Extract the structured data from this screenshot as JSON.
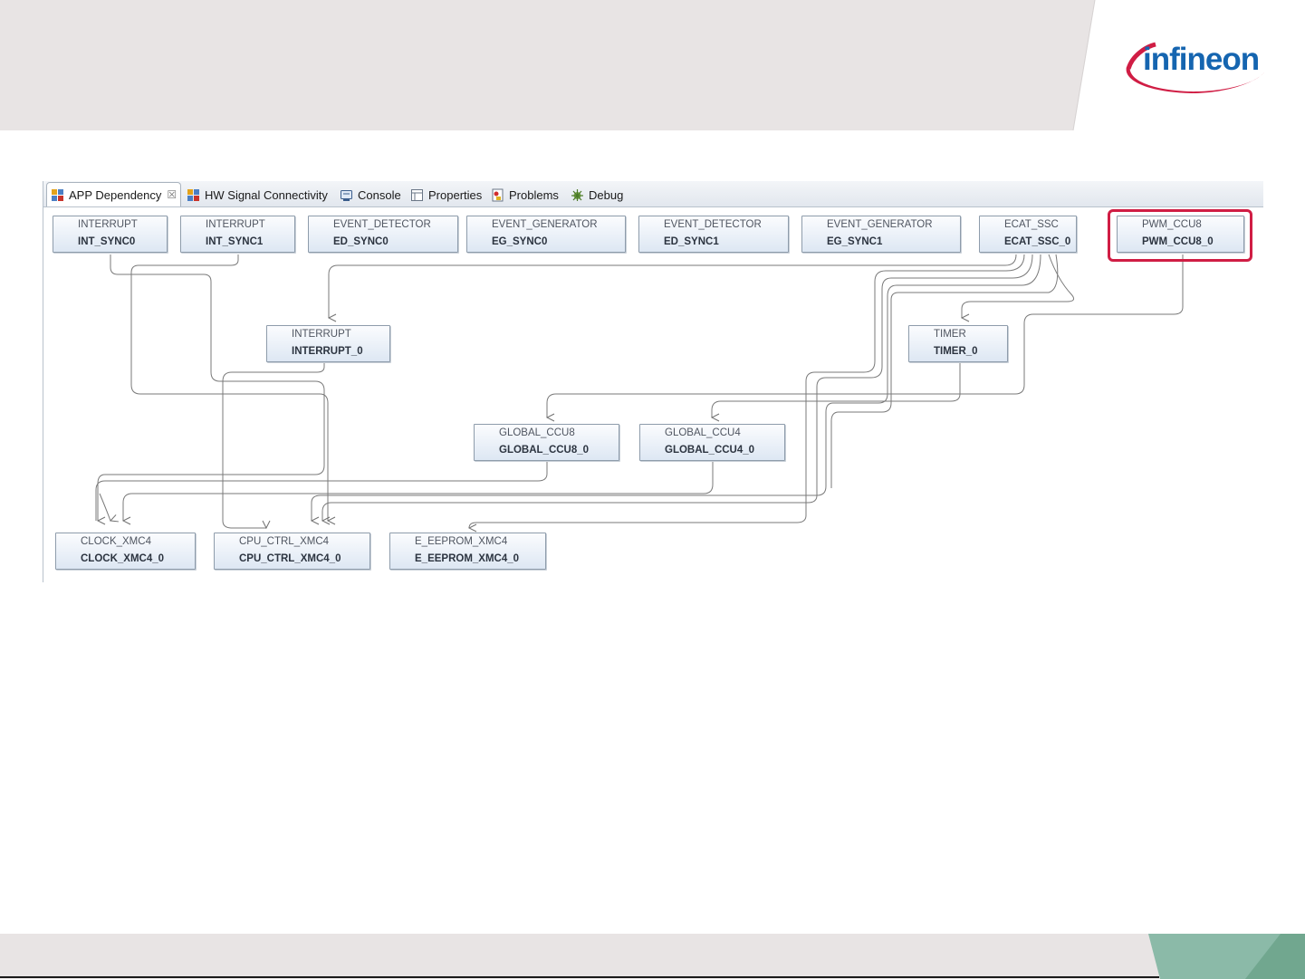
{
  "brand": {
    "logo_text": "infineon",
    "logo_color": "#1565b0",
    "swoosh_color": "#d01d44"
  },
  "tabs": [
    {
      "label": "APP Dependency",
      "icon": "app-dependency-icon",
      "active": true
    },
    {
      "label": "HW Signal Connectivity",
      "icon": "hw-signal-icon"
    },
    {
      "label": "Console",
      "icon": "console-icon"
    },
    {
      "label": "Properties",
      "icon": "properties-icon"
    },
    {
      "label": "Problems",
      "icon": "problems-icon"
    },
    {
      "label": "Debug",
      "icon": "debug-icon"
    }
  ],
  "close_glyph": "☒",
  "nodes": [
    {
      "type": "INTERRUPT",
      "name": "INT_SYNC0"
    },
    {
      "type": "INTERRUPT",
      "name": "INT_SYNC1"
    },
    {
      "type": "EVENT_DETECTOR",
      "name": "ED_SYNC0"
    },
    {
      "type": "EVENT_GENERATOR",
      "name": "EG_SYNC0"
    },
    {
      "type": "EVENT_DETECTOR",
      "name": "ED_SYNC1"
    },
    {
      "type": "EVENT_GENERATOR",
      "name": "EG_SYNC1"
    },
    {
      "type": "ECAT_SSC",
      "name": "ECAT_SSC_0"
    },
    {
      "type": "PWM_CCU8",
      "name": "PWM_CCU8_0",
      "highlighted": true
    },
    {
      "type": "INTERRUPT",
      "name": "INTERRUPT_0"
    },
    {
      "type": "TIMER",
      "name": "TIMER_0"
    },
    {
      "type": "GLOBAL_CCU8",
      "name": "GLOBAL_CCU8_0"
    },
    {
      "type": "GLOBAL_CCU4",
      "name": "GLOBAL_CCU4_0"
    },
    {
      "type": "CLOCK_XMC4",
      "name": "CLOCK_XMC4_0"
    },
    {
      "type": "CPU_CTRL_XMC4",
      "name": "CPU_CTRL_XMC4_0"
    },
    {
      "type": "E_EEPROM_XMC4",
      "name": "E_EEPROM_XMC4_0"
    }
  ],
  "highlight_color": "#d01d44",
  "footer_colors": {
    "light": "#8bbaa8",
    "dark": "#71a78f"
  }
}
